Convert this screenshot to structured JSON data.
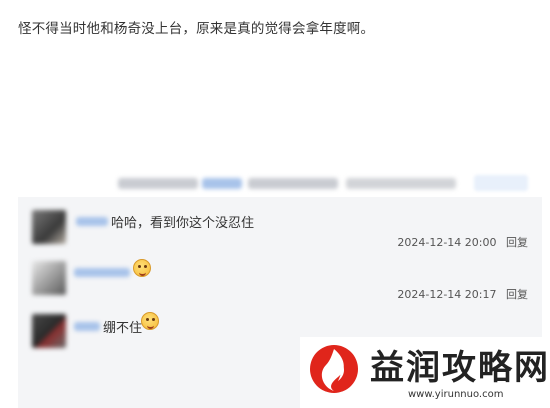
{
  "post": {
    "text": "怪不得当时他和杨奇没上台，原来是真的觉得会拿年度啊。"
  },
  "comments": [
    {
      "text": "哈哈，看到你这个没忍住",
      "time": "2024-12-14 20:00",
      "reply": "回复"
    },
    {
      "text": "",
      "emoji": "smile-emoji-icon",
      "time": "2024-12-14 20:17",
      "reply": "回复"
    },
    {
      "text": "绷不住",
      "emoji": "laugh-emoji-icon",
      "time": "",
      "reply": ""
    }
  ],
  "watermark": {
    "title": "益润攻略网",
    "url": "www.yirunnuo.com",
    "color": "#e0251b"
  }
}
